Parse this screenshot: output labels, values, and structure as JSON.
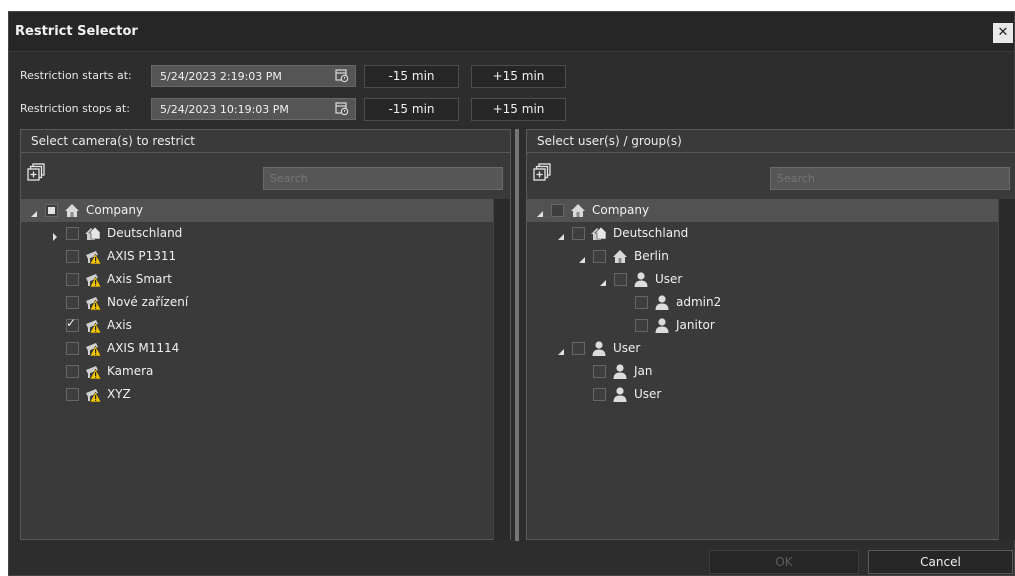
{
  "dialog": {
    "title": "Restrict Selector",
    "close_label": "✕"
  },
  "restriction": {
    "start_label": "Restriction starts at:",
    "start_value": "5/24/2023 2:19:03 PM",
    "stop_label": "Restriction stops at:",
    "stop_value": "5/24/2023 10:19:03 PM",
    "minus_label": "-15 min",
    "plus_label": "+15 min"
  },
  "cameras_panel": {
    "title": "Select camera(s) to restrict",
    "search_placeholder": "Search",
    "tree": [
      {
        "label": "Company",
        "icon": "home-icon",
        "expander": "expanded",
        "checkbox": "partial",
        "indent": 0,
        "highlighted": true
      },
      {
        "label": "Deutschland",
        "icon": "site-icon",
        "expander": "collapsed",
        "checkbox": "unchecked",
        "indent": 1
      },
      {
        "label": "AXIS P1311",
        "icon": "camera-warning-icon",
        "expander": "none",
        "checkbox": "unchecked",
        "indent": 1
      },
      {
        "label": "Axis Smart",
        "icon": "camera-warning-icon",
        "expander": "none",
        "checkbox": "unchecked",
        "indent": 1
      },
      {
        "label": "Nové zařízení",
        "icon": "camera-warning-icon",
        "expander": "none",
        "checkbox": "unchecked",
        "indent": 1
      },
      {
        "label": "Axis",
        "icon": "camera-warning-icon",
        "expander": "none",
        "checkbox": "checked",
        "indent": 1
      },
      {
        "label": "AXIS M1114",
        "icon": "camera-warning-icon",
        "expander": "none",
        "checkbox": "unchecked",
        "indent": 1
      },
      {
        "label": "Kamera",
        "icon": "camera-warning-icon",
        "expander": "none",
        "checkbox": "unchecked",
        "indent": 1
      },
      {
        "label": "XYZ",
        "icon": "camera-warning-icon",
        "expander": "none",
        "checkbox": "unchecked",
        "indent": 1
      }
    ]
  },
  "users_panel": {
    "title": "Select user(s) / group(s)",
    "search_placeholder": "Search",
    "tree": [
      {
        "label": "Company",
        "icon": "home-icon",
        "expander": "expanded",
        "checkbox": "unchecked",
        "indent": 0,
        "highlighted": true
      },
      {
        "label": "Deutschland",
        "icon": "site-icon",
        "expander": "expanded",
        "checkbox": "unchecked",
        "indent": 1
      },
      {
        "label": "Berlin",
        "icon": "home-icon",
        "expander": "expanded",
        "checkbox": "unchecked",
        "indent": 2
      },
      {
        "label": "User",
        "icon": "user-icon",
        "expander": "expanded",
        "checkbox": "unchecked",
        "indent": 3
      },
      {
        "label": "admin2",
        "icon": "user-icon",
        "expander": "none",
        "checkbox": "unchecked",
        "indent": 4
      },
      {
        "label": "Janitor",
        "icon": "user-icon",
        "expander": "none",
        "checkbox": "unchecked",
        "indent": 4
      },
      {
        "label": "User",
        "icon": "user-icon",
        "expander": "expanded",
        "checkbox": "unchecked",
        "indent": 1
      },
      {
        "label": "Jan",
        "icon": "user-icon",
        "expander": "none",
        "checkbox": "unchecked",
        "indent": 2
      },
      {
        "label": "User",
        "icon": "user-icon",
        "expander": "none",
        "checkbox": "unchecked",
        "indent": 2
      }
    ]
  },
  "footer": {
    "ok_label": "OK",
    "ok_disabled": true,
    "cancel_label": "Cancel"
  },
  "colors": {
    "background": "#2d2d2d",
    "panel": "#3a3a3a",
    "warning": "#f2c500",
    "text": "#f0f0f0"
  }
}
